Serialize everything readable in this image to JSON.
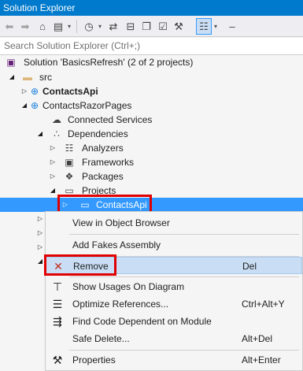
{
  "window": {
    "title": "Solution Explorer"
  },
  "search": {
    "placeholder": "Search Solution Explorer (Ctrl+;)"
  },
  "toolbar": {
    "icons": [
      "back-icon",
      "forward-icon",
      "home-icon",
      "switch-views-icon",
      "pending-changes-icon",
      "sync-icon",
      "collapse-all-icon",
      "show-all-files-icon",
      "properties-icon",
      "preview-icon",
      "pin-icon"
    ]
  },
  "tree": {
    "solution": "Solution 'BasicsRefresh' (2 of 2 projects)",
    "src": "src",
    "contacts_api": "ContactsApi",
    "contacts_razor": "ContactsRazorPages",
    "connected_services": "Connected Services",
    "dependencies": "Dependencies",
    "analyzers": "Analyzers",
    "frameworks": "Frameworks",
    "packages": "Packages",
    "projects": "Projects",
    "projects_contacts_api": "ContactsApi"
  },
  "context_menu": {
    "view_object_browser": "View in Object Browser",
    "add_fakes": "Add Fakes Assembly",
    "remove": "Remove",
    "remove_key": "Del",
    "show_usages": "Show Usages On Diagram",
    "optimize_refs": "Optimize References...",
    "optimize_refs_key": "Ctrl+Alt+Y",
    "find_code": "Find Code Dependent on Module",
    "safe_delete": "Safe Delete...",
    "safe_delete_key": "Alt+Del",
    "properties": "Properties",
    "properties_key": "Alt+Enter"
  },
  "colors": {
    "title_bg": "#007acc",
    "selection": "#3399ff",
    "highlight_box": "#e00000",
    "menu_hover": "#c9def5"
  }
}
